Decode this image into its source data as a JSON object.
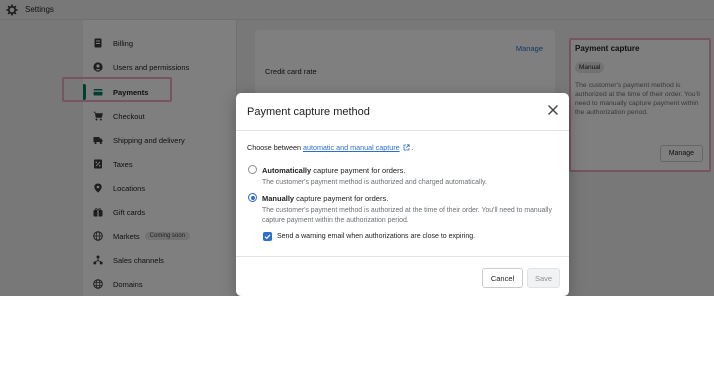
{
  "window": {
    "title": "Settings",
    "icon": "gear-icon"
  },
  "sidebar": {
    "items": [
      {
        "label": "Billing",
        "icon": "billing-icon",
        "active": false
      },
      {
        "label": "Users and permissions",
        "icon": "user-icon",
        "active": false
      },
      {
        "label": "Payments",
        "icon": "payments-icon",
        "active": true
      },
      {
        "label": "Checkout",
        "icon": "cart-icon",
        "active": false
      },
      {
        "label": "Shipping and delivery",
        "icon": "truck-icon",
        "active": false
      },
      {
        "label": "Taxes",
        "icon": "taxes-icon",
        "active": false
      },
      {
        "label": "Locations",
        "icon": "location-pin-icon",
        "active": false
      },
      {
        "label": "Gift cards",
        "icon": "gift-card-icon",
        "active": false
      },
      {
        "label": "Markets",
        "icon": "globe-icon",
        "active": false,
        "badge": "Coming soon"
      },
      {
        "label": "Sales channels",
        "icon": "sales-channels-icon",
        "active": false
      },
      {
        "label": "Domains",
        "icon": "domains-globe-icon",
        "active": false
      }
    ]
  },
  "main": {
    "manage_link": "Manage",
    "credit_card_rate_label": "Credit card rate"
  },
  "payment_capture_card": {
    "title": "Payment capture",
    "badge": "Manual",
    "description": "The customer's payment method is authorized at the time of their order. You'll need to manually capture payment within the authorization period.",
    "button": "Manage"
  },
  "modal": {
    "title": "Payment capture method",
    "intro_prefix": "Choose between",
    "intro_link": "automatic and manual capture",
    "intro_suffix": ".",
    "options": [
      {
        "label_bold": "Automatically",
        "label_rest": " capture payment for orders.",
        "description": "The customer's payment method is authorized and charged automatically.",
        "selected": false
      },
      {
        "label_bold": "Manually",
        "label_rest": " capture payment for orders.",
        "description": "The customer's payment method is authorized at the time of their order. You'll need to manually capture payment within the authorization period.",
        "selected": true
      }
    ],
    "warning_checkbox": {
      "label": "Send a warning email when authorizations are close to expiring.",
      "checked": true
    },
    "cancel_button": "Cancel",
    "save_button": "Save"
  },
  "colors": {
    "accent_blue": "#2c6ecb",
    "active_green": "#008060",
    "highlight_pink": "#f0a6c5"
  }
}
